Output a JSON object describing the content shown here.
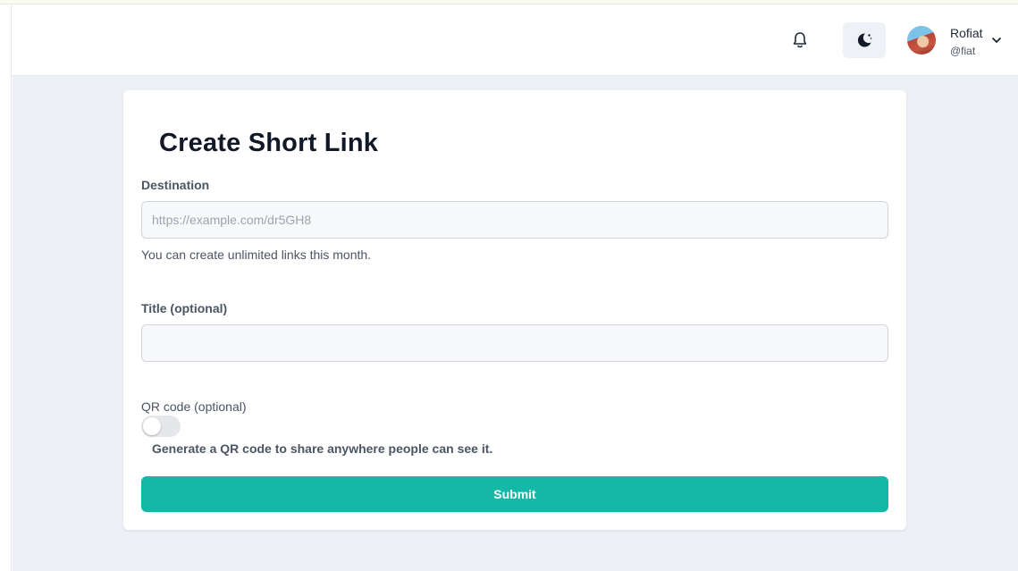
{
  "header": {
    "notification_icon": "bell-icon",
    "theme_icon": "moon-stars-icon",
    "user": {
      "name": "Rofiat",
      "handle": "@fiat",
      "avatar_icon": "avatar",
      "menu_icon": "chevron-down-icon"
    }
  },
  "form": {
    "title": "Create Short Link",
    "destination": {
      "label": "Destination",
      "value": "",
      "placeholder": "https://example.com/dr5GH8",
      "hint": "You can create unlimited links this month."
    },
    "link_title": {
      "label": "Title (optional)",
      "value": "",
      "placeholder": ""
    },
    "qr": {
      "label": "QR code (optional)",
      "enabled": false,
      "description": "Generate a QR code to share anywhere people can see it."
    },
    "submit_label": "Submit"
  },
  "colors": {
    "accent": "#14b8a6",
    "page_background": "#edf1f5",
    "card_background": "#ffffff"
  }
}
